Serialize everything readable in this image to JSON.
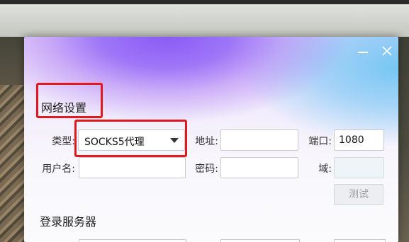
{
  "dialog": {
    "window_controls": {
      "minimize_icon": "minimize-icon",
      "close_icon": "close-icon"
    },
    "network": {
      "title": "网络设置",
      "type_label": "类型:",
      "type_value": "SOCKS5代理",
      "address_label": "地址:",
      "address_value": "",
      "port_label": "端口:",
      "port_value": "1080",
      "username_label": "用户名:",
      "username_value": "",
      "password_label": "密码:",
      "password_value": "",
      "domain_label": "域:",
      "domain_value": "",
      "test_button": "测试"
    },
    "login": {
      "title": "登录服务器"
    }
  },
  "colors": {
    "highlight": "#e0191e",
    "accent_purple": "#8b5cf6",
    "accent_blue": "#76c7f4"
  }
}
